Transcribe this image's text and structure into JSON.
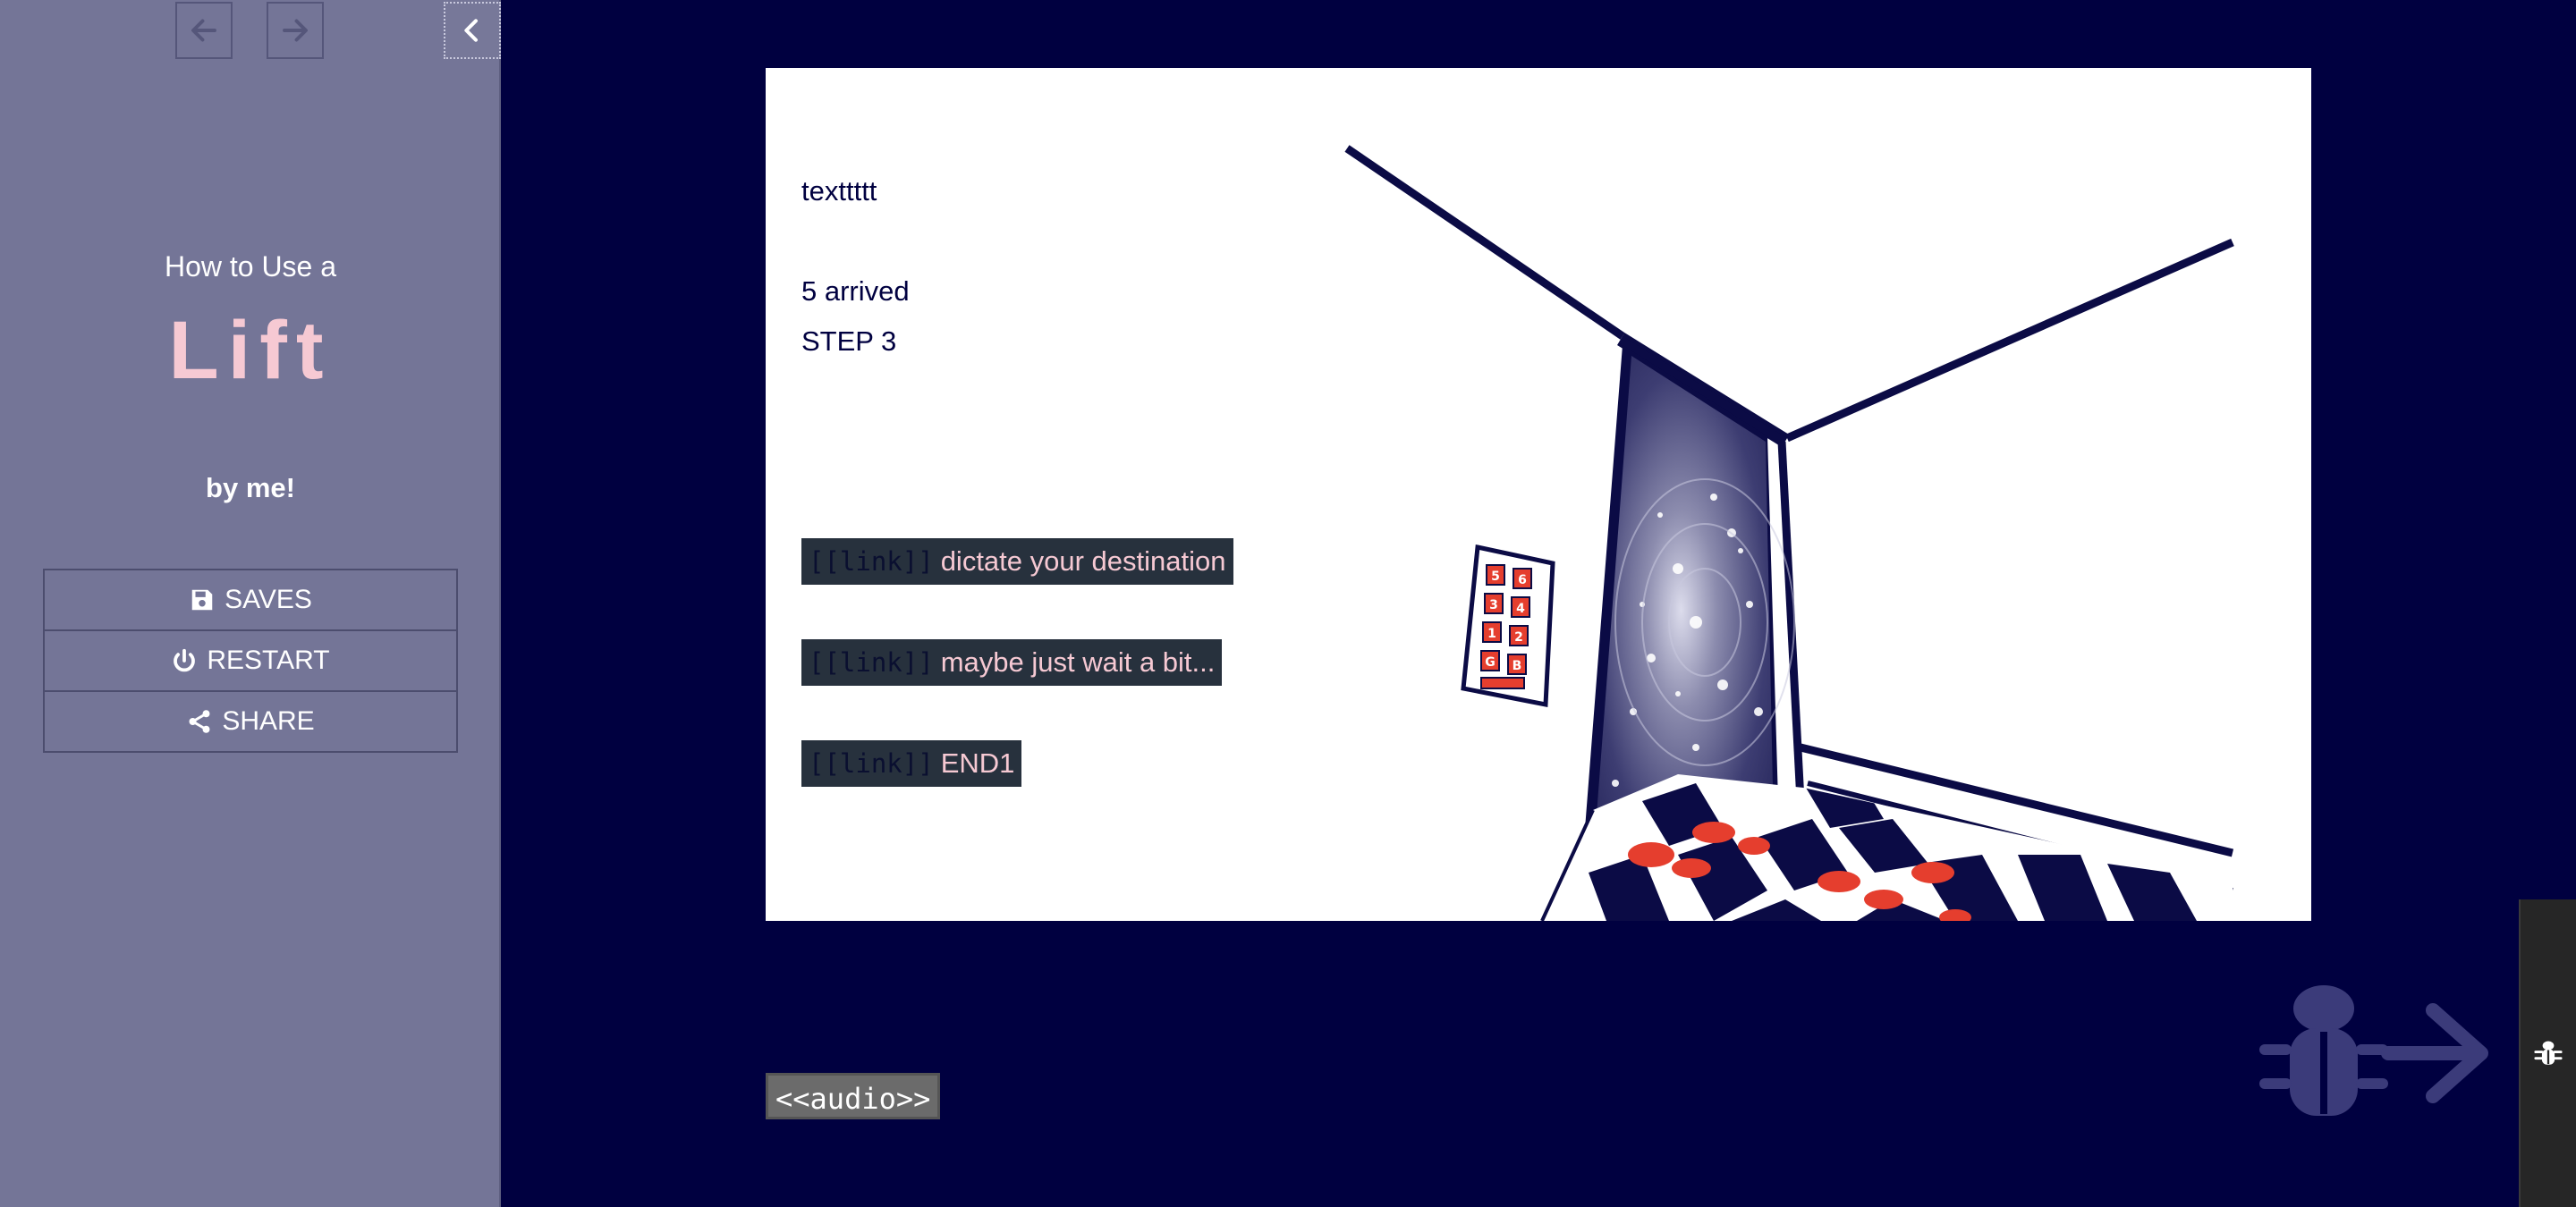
{
  "sidebar": {
    "story": {
      "pre_title": "How to Use a",
      "title": "Lift",
      "author": "by me!"
    },
    "history": {
      "back_icon": "arrow-left-icon",
      "forward_icon": "arrow-right-icon",
      "toggle_icon": "chevron-left-icon"
    },
    "menu": [
      {
        "label": "SAVES",
        "icon": "save-icon"
      },
      {
        "label": "RESTART",
        "icon": "power-icon"
      },
      {
        "label": "SHARE",
        "icon": "share-icon"
      }
    ]
  },
  "passage": {
    "lines": [
      "texttttt",
      "5 arrived",
      "STEP 3"
    ],
    "links": [
      {
        "tag": "[[link]]",
        "label": "dictate your destination"
      },
      {
        "tag": "[[link]]",
        "label": "maybe just wait a bit..."
      },
      {
        "tag": "[[link]]",
        "label": "END1"
      }
    ],
    "elevator_panel": {
      "buttons": [
        "5",
        "6",
        "3",
        "4",
        "1",
        "2",
        "G",
        "B"
      ]
    }
  },
  "audio_macro": "<<audio>>",
  "debug": {
    "icon": "bug-icon",
    "graphic": "bug-arrow-icon"
  },
  "colors": {
    "background": "#000040",
    "sidebar": "#747597",
    "title_accent": "#f6c9d3",
    "link_bg": "#27313d",
    "scene_ink": "#0b0b45",
    "footprint_red": "#e53e2e"
  }
}
